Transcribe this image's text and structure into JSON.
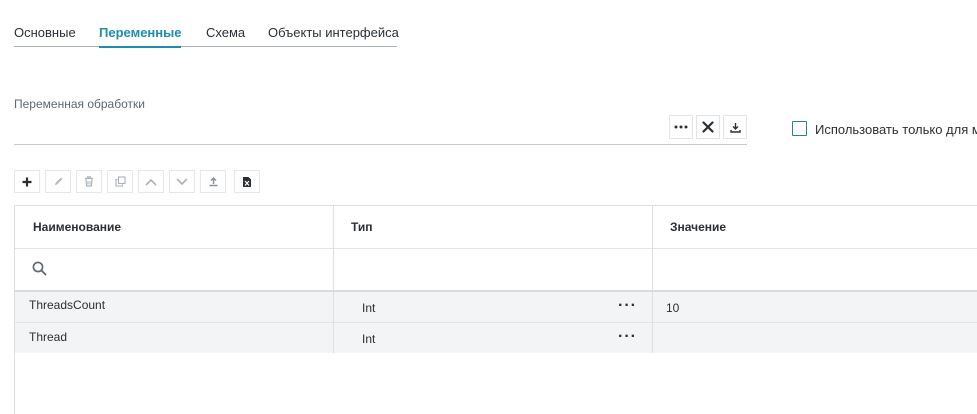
{
  "tabs": [
    {
      "label": "Основные",
      "active": false
    },
    {
      "label": "Переменные",
      "active": true
    },
    {
      "label": "Схема",
      "active": false
    },
    {
      "label": "Объекты интерфейса",
      "active": false
    }
  ],
  "variable_field": {
    "label": "Переменная обработки",
    "value": ""
  },
  "checkbox": {
    "label": "Использовать только для м",
    "checked": false
  },
  "toolbar_icons": [
    "plus-icon",
    "pencil-icon",
    "trash-icon",
    "copy-icon",
    "chevron-up-icon",
    "chevron-down-icon",
    "upload-icon",
    "excel-icon"
  ],
  "grid": {
    "columns": [
      "Наименование",
      "Тип",
      "Значение"
    ],
    "rows": [
      {
        "name": "ThreadsCount",
        "type": "Int",
        "value": "10"
      },
      {
        "name": "Thread",
        "type": "Int",
        "value": ""
      }
    ],
    "row_action": "···"
  },
  "colors": {
    "accent": "#1e8cb0",
    "row_bg": "#f2f4f6",
    "border": "#dadfe3"
  }
}
